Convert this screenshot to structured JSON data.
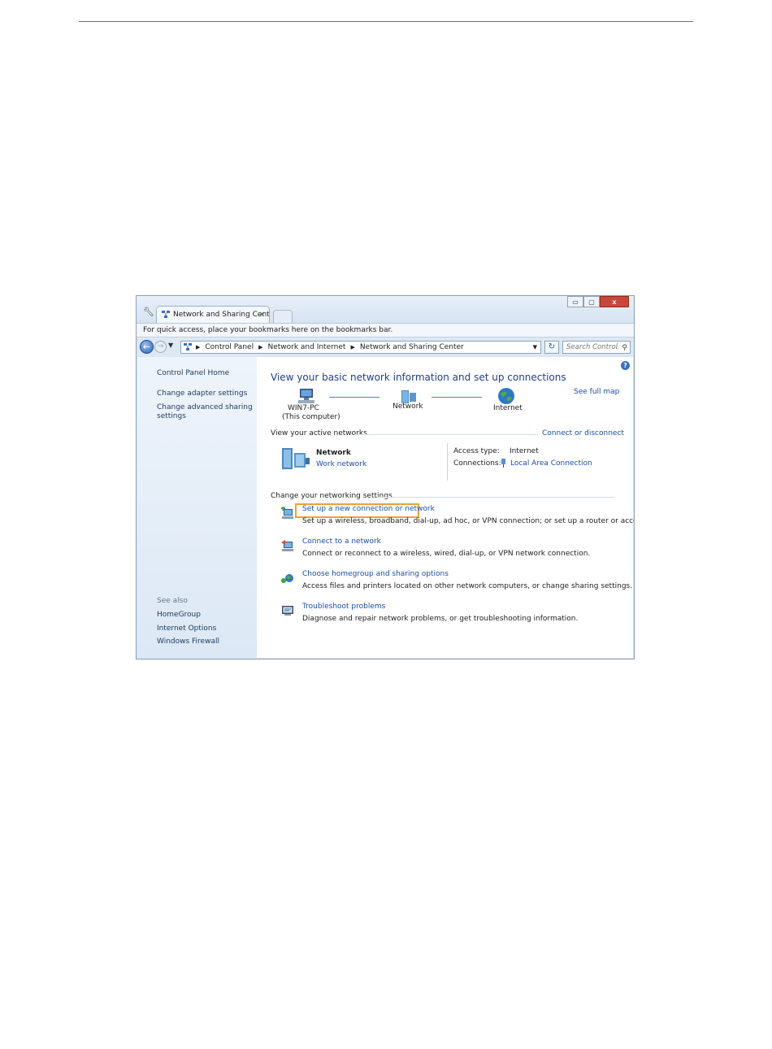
{
  "browser": {
    "tab_title": "Network and Sharing Cent",
    "bookmarks_hint": "For quick access, place your bookmarks here on the bookmarks bar.",
    "breadcrumbs": [
      "Control Panel",
      "Network and Internet",
      "Network and Sharing Center"
    ],
    "search_placeholder": "Search Control...",
    "close_glyph": "×",
    "window_buttons": {
      "minimize": "▭",
      "maximize": "▢",
      "close": "x"
    }
  },
  "sidebar": {
    "home": "Control Panel Home",
    "links": [
      "Change adapter settings",
      "Change advanced sharing",
      "settings"
    ],
    "see_also_label": "See also",
    "see_also": [
      "HomeGroup",
      "Internet Options",
      "Windows Firewall"
    ]
  },
  "main": {
    "title": "View your basic network information and set up connections",
    "see_full_map": "See full map",
    "map": {
      "computer_name": "WIN7-PC",
      "computer_sub": "(This computer)",
      "network": "Network",
      "internet": "Internet"
    },
    "active_networks": {
      "heading": "View your active networks",
      "connect_link": "Connect or disconnect",
      "network_name": "Network",
      "network_type": "Work network",
      "access_type_label": "Access type:",
      "access_type_value": "Internet",
      "connections_label": "Connections:",
      "connections_value": "Local Area Connection"
    },
    "settings": {
      "heading": "Change your networking settings",
      "tasks": [
        {
          "title": "Set up a new connection or network",
          "desc": "Set up a wireless, broadband, dial-up, ad hoc, or VPN connection; or set up a router or access point."
        },
        {
          "title": "Connect to a network",
          "desc": "Connect or reconnect to a wireless, wired, dial-up, or VPN network connection."
        },
        {
          "title": "Choose homegroup and sharing options",
          "desc": "Access files and printers located on other network computers, or change sharing settings."
        },
        {
          "title": "Troubleshoot problems",
          "desc": "Diagnose and repair network problems, or get troubleshooting information."
        }
      ]
    }
  },
  "colors": {
    "highlight": "#e9a23a",
    "link": "#1a4ea8",
    "heading": "#1e3f8a"
  }
}
